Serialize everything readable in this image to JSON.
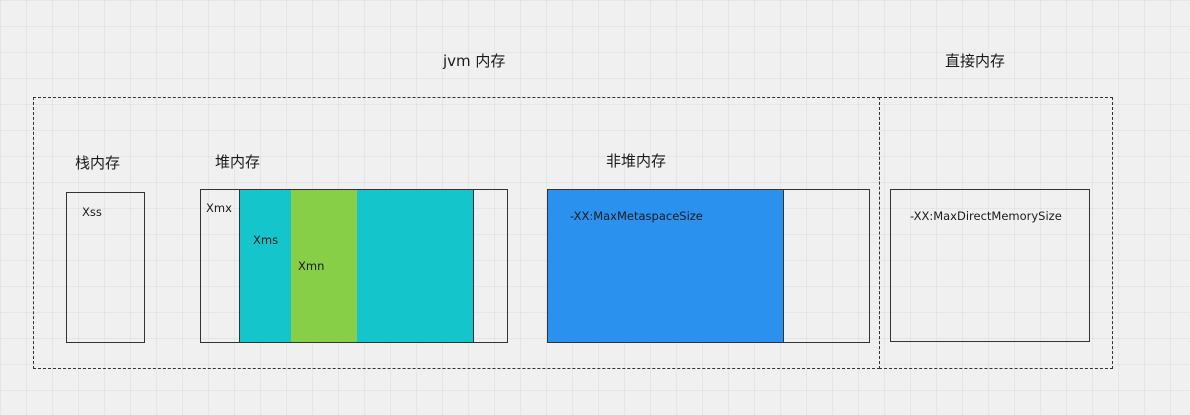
{
  "titles": {
    "jvm_memory": "jvm 内存",
    "direct_memory": "直接内存",
    "stack_memory": "栈内存",
    "heap_memory": "堆内存",
    "non_heap_memory": "非堆内存"
  },
  "labels": {
    "xss": "Xss",
    "xmx": "Xmx",
    "xms": "Xms",
    "xmn": "Xmn",
    "max_metaspace": "-XX:MaxMetaspaceSize",
    "max_direct_memory": "-XX:MaxDirectMemorySize"
  },
  "colors": {
    "background": "#f0f0f0",
    "teal": "#14c5cc",
    "green": "#86cf47",
    "blue": "#2a91ee",
    "border": "#333333"
  }
}
